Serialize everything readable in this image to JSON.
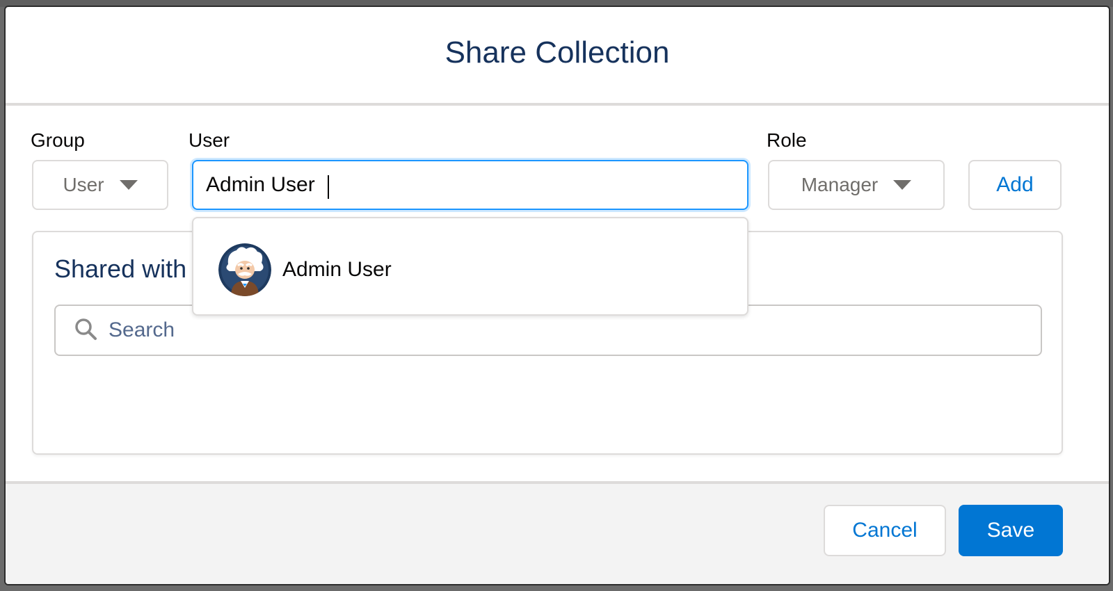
{
  "modal": {
    "title": "Share Collection"
  },
  "form": {
    "group": {
      "label": "Group",
      "value": "User"
    },
    "user": {
      "label": "User",
      "value": "Admin User"
    },
    "role": {
      "label": "Role",
      "value": "Manager"
    },
    "add_label": "Add"
  },
  "suggestions": [
    {
      "name": "Admin User",
      "avatar_icon": "einstein-avatar-icon"
    }
  ],
  "shared": {
    "title": "Shared with",
    "search_placeholder": "Search"
  },
  "footer": {
    "cancel_label": "Cancel",
    "save_label": "Save"
  },
  "colors": {
    "brand": "#0176d3",
    "title": "#16325c",
    "border": "#dddbda",
    "focus": "#1b96ff",
    "footer_bg": "#f3f3f3"
  }
}
